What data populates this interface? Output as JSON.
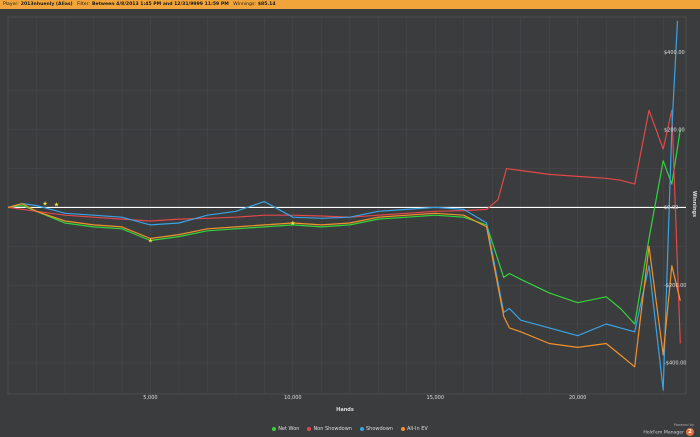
{
  "header": {
    "player_label": "Player:",
    "player_value": "2013nhuenly (Alias)",
    "filter_label": "Filter:",
    "filter_value": "Between 4/8/2013 1:45 PM and 12/31/9999 11:59 PM",
    "winnings_label": "Winnings:",
    "winnings_value": "$85.14"
  },
  "branding": {
    "powered_by": "Powered by",
    "product": "Hold'em Manager",
    "badge": "2"
  },
  "chart_data": {
    "type": "line",
    "xlabel": "Hands",
    "ylabel": "Winnings",
    "xlim": [
      0,
      23800
    ],
    "ylim": [
      -480,
      490
    ],
    "x_ticks": [
      5000,
      10000,
      15000,
      20000
    ],
    "x_tick_labels": [
      "5,000",
      "10,000",
      "15,000",
      "20,000"
    ],
    "y_ticks": [
      400,
      200,
      0,
      -200,
      -400
    ],
    "y_tick_labels": [
      "$400.00",
      "$200.00",
      "$0.00",
      "-$200.00",
      "-$400.00"
    ],
    "grid": true,
    "legend_position": "bottom",
    "series": [
      {
        "name": "Net Won",
        "color": "#33d43a",
        "x": [
          0,
          500,
          1000,
          1500,
          2000,
          3000,
          4000,
          5000,
          6000,
          7000,
          8000,
          9000,
          10000,
          11000,
          12000,
          13000,
          14000,
          15000,
          16000,
          16800,
          17400,
          17600,
          18000,
          19000,
          20000,
          21000,
          21500,
          22000,
          22500,
          23000,
          23300,
          23600
        ],
        "y": [
          0,
          5,
          -10,
          -25,
          -40,
          -50,
          -55,
          -85,
          -75,
          -60,
          -55,
          -50,
          -45,
          -50,
          -45,
          -30,
          -25,
          -20,
          -25,
          -45,
          -180,
          -170,
          -185,
          -220,
          -245,
          -230,
          -260,
          -300,
          -80,
          120,
          60,
          200
        ]
      },
      {
        "name": "Non Showdown",
        "color": "#e0484a",
        "x": [
          0,
          1000,
          2000,
          3000,
          4000,
          5000,
          6000,
          7000,
          8000,
          9000,
          10000,
          11000,
          12000,
          13000,
          14000,
          15000,
          16000,
          16800,
          17200,
          17500,
          18000,
          19000,
          20000,
          21000,
          21500,
          22000,
          22500,
          23000,
          23300,
          23600
        ],
        "y": [
          0,
          -10,
          -20,
          -25,
          -30,
          -35,
          -30,
          -28,
          -25,
          -20,
          -20,
          -22,
          -25,
          -20,
          -15,
          -10,
          -8,
          -5,
          20,
          100,
          95,
          85,
          80,
          75,
          70,
          60,
          250,
          150,
          250,
          -350
        ]
      },
      {
        "name": "Showdown",
        "color": "#3aa3e3",
        "x": [
          0,
          500,
          1000,
          2000,
          3000,
          4000,
          5000,
          6000,
          7000,
          8000,
          9000,
          10000,
          11000,
          12000,
          13000,
          14000,
          15000,
          16000,
          16800,
          17400,
          17600,
          18000,
          19000,
          20000,
          21000,
          21500,
          22000,
          22500,
          23000,
          23300,
          23500
        ],
        "y": [
          0,
          10,
          5,
          -15,
          -20,
          -25,
          -45,
          -40,
          -20,
          -10,
          15,
          -25,
          -28,
          -25,
          -10,
          -5,
          0,
          -5,
          -40,
          -270,
          -260,
          -290,
          -310,
          -330,
          -300,
          -310,
          -320,
          -150,
          -470,
          200,
          480
        ]
      },
      {
        "name": "All-In EV",
        "color": "#f0922b",
        "x": [
          0,
          500,
          1000,
          2000,
          3000,
          4000,
          5000,
          6000,
          7000,
          8000,
          9000,
          10000,
          11000,
          12000,
          13000,
          14000,
          15000,
          16000,
          16800,
          17400,
          17600,
          18000,
          19000,
          20000,
          21000,
          21500,
          22000,
          22500,
          23000,
          23300,
          23600
        ],
        "y": [
          0,
          10,
          -10,
          -35,
          -45,
          -50,
          -80,
          -70,
          -55,
          -50,
          -45,
          -40,
          -45,
          -40,
          -25,
          -20,
          -15,
          -20,
          -50,
          -280,
          -310,
          -320,
          -350,
          -360,
          -350,
          -380,
          -410,
          -100,
          -380,
          -150,
          -240
        ]
      }
    ],
    "star_markers": [
      {
        "x": 1300,
        "y": 10
      },
      {
        "x": 1700,
        "y": 8
      },
      {
        "x": 5000,
        "y": -85
      },
      {
        "x": 10000,
        "y": -40
      }
    ]
  }
}
